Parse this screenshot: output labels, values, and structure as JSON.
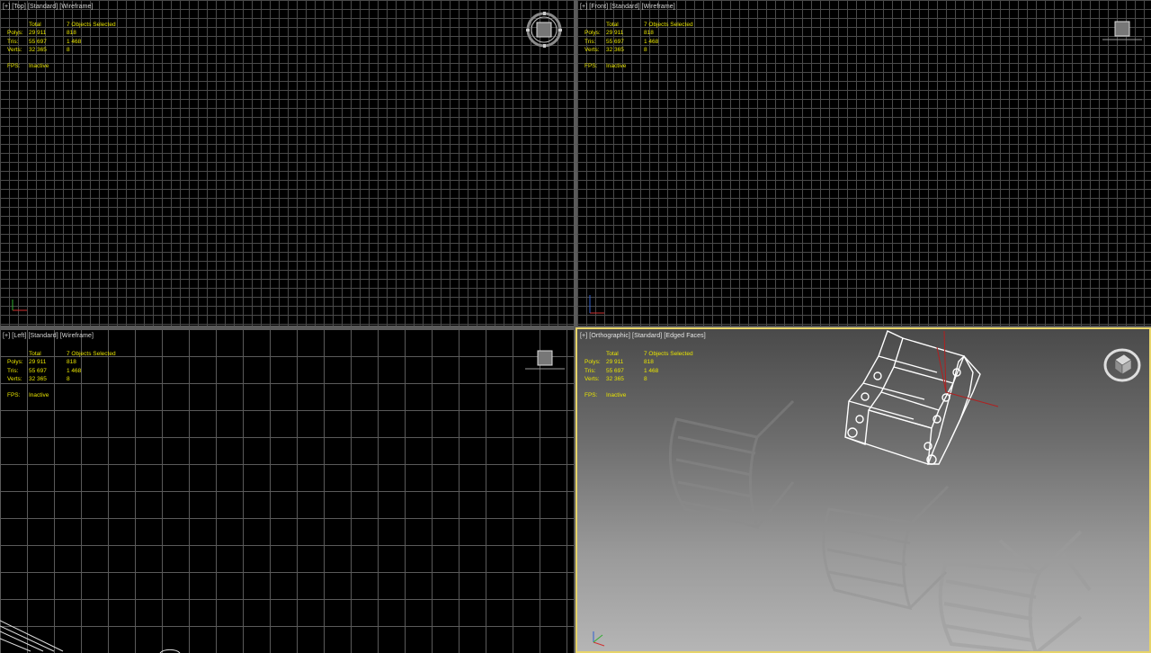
{
  "viewports": {
    "top": {
      "label": [
        "[+]",
        "[Top]",
        "[Standard]",
        "[Wireframe]"
      ],
      "active": false
    },
    "front": {
      "label": [
        "[+]",
        "[Front]",
        "[Standard]",
        "[Wireframe]"
      ],
      "active": false
    },
    "left": {
      "label": [
        "[+]",
        "[Left]",
        "[Standard]",
        "[Wireframe]"
      ],
      "active": false
    },
    "orthographic": {
      "label": [
        "[+]",
        "[Orthographic]",
        "[Standard]",
        "[Edged Faces]"
      ],
      "active": true
    }
  },
  "stats": {
    "header_total": "Total",
    "header_selected": "7 Objects Selected",
    "rows": [
      {
        "name": "Polys:",
        "total": "29 911",
        "selected": "818"
      },
      {
        "name": "Tris:",
        "total": "55 697",
        "selected": "1 468"
      },
      {
        "name": "Verts:",
        "total": "32 365",
        "selected": "8"
      }
    ],
    "fps_label": "FPS:",
    "fps_value": "Inactive"
  },
  "colors": {
    "active_border": "#e6d36a",
    "stats_text": "#e8e400",
    "grid_line": "#4a4a4a"
  },
  "icons": {
    "navigation": "viewcube-icon",
    "steering_wheel": "navigation-ring-icon",
    "axis_tripod": "axis-tripod-icon"
  }
}
